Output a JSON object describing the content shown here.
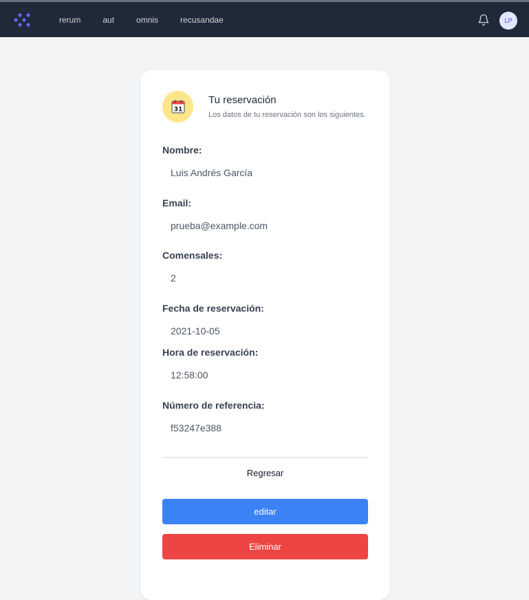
{
  "nav": {
    "links": [
      "rerum",
      "aut",
      "omnis",
      "recusandae"
    ],
    "avatar_initials": "LP",
    "logo_icon": "dots-logo-icon",
    "bell_icon": "bell-icon"
  },
  "card": {
    "icon": "calendar-icon",
    "calendar_day": "31",
    "title": "Tu reservación",
    "subtitle": "Los datos de tu reservación son los siguientes.",
    "fields": [
      {
        "label": "Nombre:",
        "value": "Luis Andrés García"
      },
      {
        "label": "Email:",
        "value": "prueba@example.com"
      },
      {
        "label": "Comensales:",
        "value": "2"
      },
      {
        "label": "Fecha de reservación:",
        "value": "2021-10-05"
      },
      {
        "label": "Hora de reservación:",
        "value": "12:58:00"
      },
      {
        "label": "Número de referencia:",
        "value": "f53247e388"
      }
    ],
    "back_label": "Regresar",
    "edit_label": "editar",
    "delete_label": "Eliminar"
  },
  "colors": {
    "navbar": "#1f2937",
    "accent": "#6366f1",
    "edit": "#3b82f6",
    "delete": "#ef4444",
    "icon_bg": "#fde68a"
  }
}
